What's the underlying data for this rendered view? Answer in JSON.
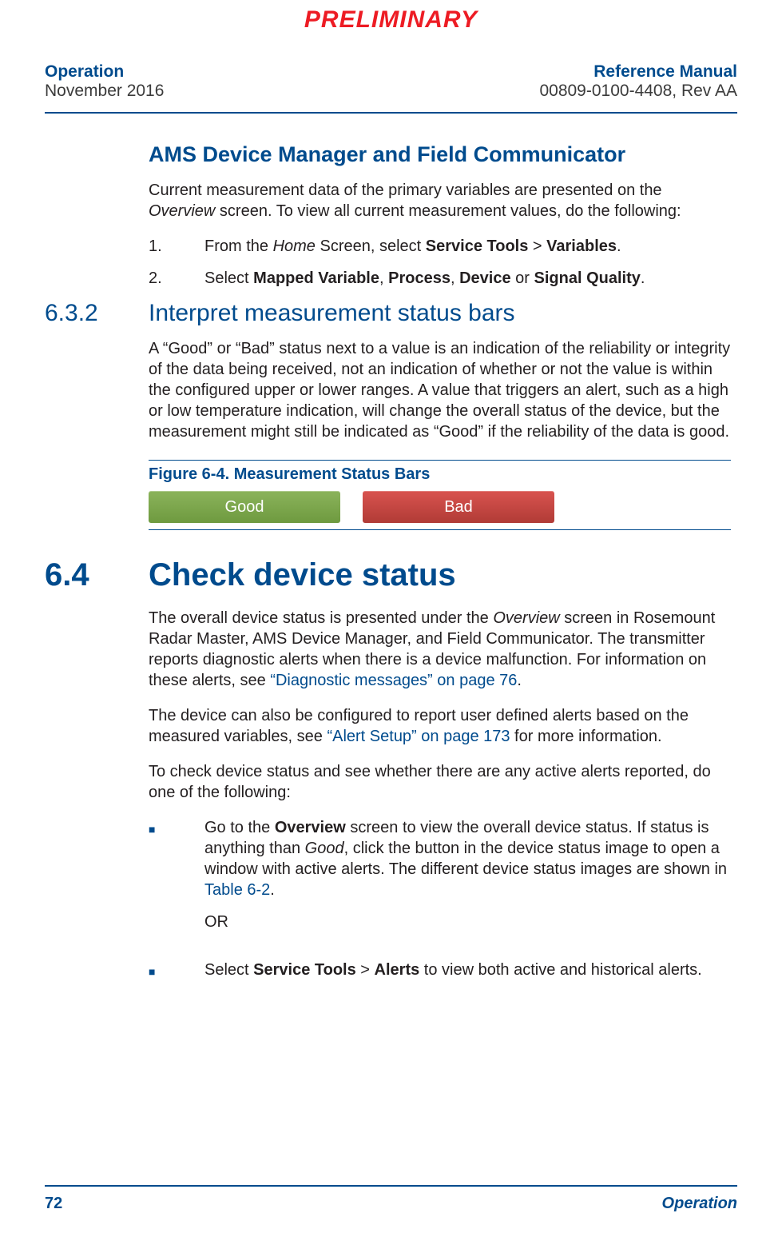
{
  "watermark": "PRELIMINARY",
  "header": {
    "left_title": "Operation",
    "left_date": "November 2016",
    "right_title": "Reference Manual",
    "right_doc": "00809-0100-4408, Rev AA"
  },
  "h3_ams": "AMS Device Manager and Field Communicator",
  "ams_intro_a": "Current measurement data of the primary variables are presented on the ",
  "ams_intro_overview": "Overview",
  "ams_intro_b": " screen. To view all current measurement values, do the following:",
  "step1": {
    "num": "1.",
    "a": "From the ",
    "home": "Home",
    "b": " Screen, select ",
    "bold1": "Service Tools",
    "gt": " > ",
    "bold2": "Variables",
    "end": "."
  },
  "step2": {
    "num": "2.",
    "a": "Select ",
    "b1": "Mapped Variable",
    "c1": ", ",
    "b2": "Process",
    "c2": ", ",
    "b3": "Device",
    "c3": " or ",
    "b4": "Signal Quality",
    "end": "."
  },
  "sec632": {
    "num": "6.3.2",
    "title": "Interpret measurement status bars"
  },
  "p632": "A “Good” or “Bad” status next to a value is an indication of the reliability or integrity of the data being received, not an indication of whether or not the value is within the configured upper or lower ranges. A value that triggers an alert, such as a high or low temperature indication, will change the overall status of the device, but the measurement might still be indicated as “Good” if the reliability of the data is good.",
  "fig_caption": "Figure 6-4. Measurement Status Bars",
  "badge_good": "Good",
  "badge_bad": "Bad",
  "sec64": {
    "num": "6.4",
    "title": "Check device status"
  },
  "p64a_1": "The overall device status is presented under the ",
  "p64a_overview": "Overview",
  "p64a_2": " screen in Rosemount Radar Master, AMS Device Manager, and Field Communicator. The transmitter reports diagnostic alerts when there is a device malfunction. For information on these alerts, see ",
  "p64a_link": "“Diagnostic messages” on page 76",
  "p64a_3": ".",
  "p64b_1": "The device can also be configured to report user defined alerts based on the measured variables, see ",
  "p64b_link": "“Alert Setup” on page 173",
  "p64b_2": " for more information.",
  "p64c": "To check device status and see whether there are any active alerts reported, do one of the following:",
  "bul1_a": "Go to the ",
  "bul1_bold": "Overview",
  "bul1_b": " screen to view the overall device status. If status is anything than ",
  "bul1_good": "Good",
  "bul1_c": ", click the button in the device status image to open a window with active alerts. The different device status images are shown in ",
  "bul1_link": "Table 6-2",
  "bul1_d": ".",
  "or": "OR",
  "bul2_a": "Select ",
  "bul2_b1": "Service Tools",
  "bul2_gt": " > ",
  "bul2_b2": "Alerts",
  "bul2_c": " to view both active and historical alerts.",
  "footer": {
    "page": "72",
    "section": "Operation"
  }
}
